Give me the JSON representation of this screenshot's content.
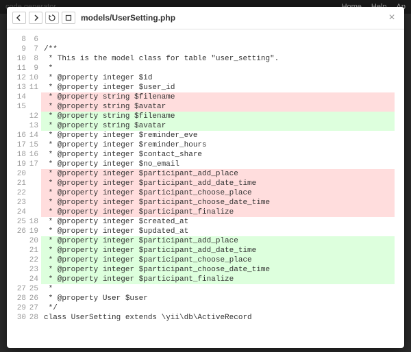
{
  "topnav": {
    "brand": "code generator",
    "links": [
      "Home",
      "Help",
      "Ap"
    ]
  },
  "header": {
    "path": "models/UserSetting.php"
  },
  "diff": {
    "lines": [
      {
        "old": "8",
        "new": "6",
        "type": "ctx",
        "text": ""
      },
      {
        "old": "9",
        "new": "7",
        "type": "ctx",
        "text": "/**"
      },
      {
        "old": "10",
        "new": "8",
        "type": "ctx",
        "text": " * This is the model class for table \"user_setting\"."
      },
      {
        "old": "11",
        "new": "9",
        "type": "ctx",
        "text": " *"
      },
      {
        "old": "12",
        "new": "10",
        "type": "ctx",
        "text": " * @property integer $id"
      },
      {
        "old": "13",
        "new": "11",
        "type": "ctx",
        "text": " * @property integer $user_id"
      },
      {
        "old": "14",
        "new": "",
        "type": "rem",
        "text": " * @property string $filename"
      },
      {
        "old": "15",
        "new": "",
        "type": "rem",
        "text": " * @property string $avatar"
      },
      {
        "old": "",
        "new": "12",
        "type": "add",
        "text": " * @property string $filename"
      },
      {
        "old": "",
        "new": "13",
        "type": "add",
        "text": " * @property string $avatar"
      },
      {
        "old": "16",
        "new": "14",
        "type": "ctx",
        "text": " * @property integer $reminder_eve"
      },
      {
        "old": "17",
        "new": "15",
        "type": "ctx",
        "text": " * @property integer $reminder_hours"
      },
      {
        "old": "18",
        "new": "16",
        "type": "ctx",
        "text": " * @property integer $contact_share"
      },
      {
        "old": "19",
        "new": "17",
        "type": "ctx",
        "text": " * @property integer $no_email"
      },
      {
        "old": "20",
        "new": "",
        "type": "rem",
        "text": " * @property integer $participant_add_place"
      },
      {
        "old": "21",
        "new": "",
        "type": "rem",
        "text": " * @property integer $participant_add_date_time"
      },
      {
        "old": "22",
        "new": "",
        "type": "rem",
        "text": " * @property integer $participant_choose_place"
      },
      {
        "old": "23",
        "new": "",
        "type": "rem",
        "text": " * @property integer $participant_choose_date_time"
      },
      {
        "old": "24",
        "new": "",
        "type": "rem",
        "text": " * @property integer $participant_finalize"
      },
      {
        "old": "25",
        "new": "18",
        "type": "ctx",
        "text": " * @property integer $created_at"
      },
      {
        "old": "26",
        "new": "19",
        "type": "ctx",
        "text": " * @property integer $updated_at"
      },
      {
        "old": "",
        "new": "20",
        "type": "add",
        "text": " * @property integer $participant_add_place"
      },
      {
        "old": "",
        "new": "21",
        "type": "add",
        "text": " * @property integer $participant_add_date_time"
      },
      {
        "old": "",
        "new": "22",
        "type": "add",
        "text": " * @property integer $participant_choose_place"
      },
      {
        "old": "",
        "new": "23",
        "type": "add",
        "text": " * @property integer $participant_choose_date_time"
      },
      {
        "old": "",
        "new": "24",
        "type": "add",
        "text": " * @property integer $participant_finalize"
      },
      {
        "old": "27",
        "new": "25",
        "type": "ctx",
        "text": " *"
      },
      {
        "old": "28",
        "new": "26",
        "type": "ctx",
        "text": " * @property User $user"
      },
      {
        "old": "29",
        "new": "27",
        "type": "ctx",
        "text": " */"
      },
      {
        "old": "30",
        "new": "28",
        "type": "ctx",
        "text": "class UserSetting extends \\yii\\db\\ActiveRecord"
      }
    ]
  }
}
